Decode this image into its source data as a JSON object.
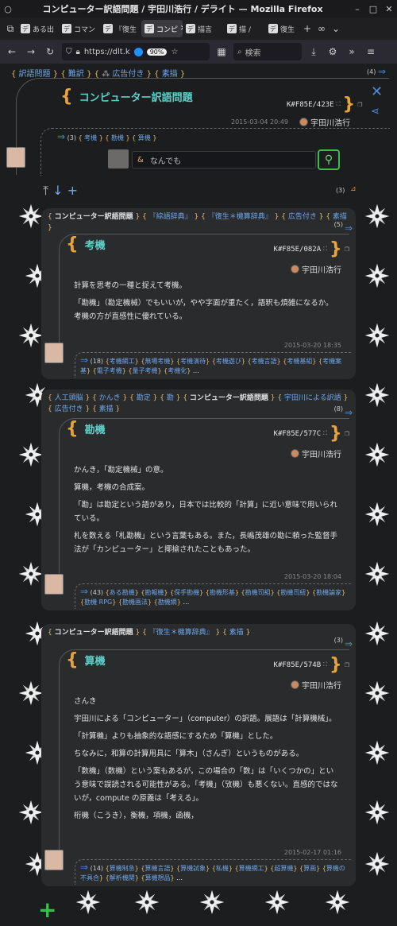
{
  "window": {
    "title": "コンピューター訳語問題 / 宇田川浩行 / デライト — Mozilla Firefox"
  },
  "tabs": [
    "ある出",
    "コマン",
    "『復生",
    "コンピ",
    "描言",
    "描 /",
    "復生"
  ],
  "nav": {
    "url": "https://dlt.k",
    "zoom": "90%",
    "search_placeholder": "検索"
  },
  "page": {
    "header_tags": [
      "訳語問題",
      "難訳",
      "広告付き",
      "素描"
    ],
    "header_count": "(4)",
    "title": "コンピューター訳語問題",
    "kid": "K#F85E/423E",
    "date": "2015-03-04 20:49",
    "author": "宇田川浩行",
    "sub_count": "(3)",
    "sub_tags": [
      "考機",
      "勘機",
      "算機"
    ],
    "input_placeholder": "なんでも",
    "child_count": "(3)"
  },
  "cards": [
    {
      "crumbs": [
        "コンピューター訳語問題",
        "『綜語辞典』",
        "『復生＊機算辞典』",
        "広告付き",
        "素描"
      ],
      "crumb_count": "(5)",
      "title": "考機",
      "kid": "K#F85E/082A",
      "author": "宇田川浩行",
      "paras": [
        "計算を思考の一種と捉えて考機。",
        "「勘機」（勘定機械）でもいいが，やや字面が重たく，語釈も煩雑になるか。考機の方が直感性に優れている。"
      ],
      "date": "2015-03-20 18:35",
      "tag_count": "(18)",
      "tags": [
        "考機網工",
        "無場考機",
        "考機演待",
        "考機遊び",
        "考機言語",
        "考機基組",
        "考機案基",
        "電子考機",
        "量子考機",
        "考機化"
      ]
    },
    {
      "crumbs": [
        "人工頭脳",
        "かんき",
        "勘定",
        "勘",
        "コンピューター訳語問題",
        "宇田川による訳語",
        "広告付き",
        "素描"
      ],
      "crumb_count": "(8)",
      "title": "勘機",
      "kid": "K#F85E/577C",
      "author": "宇田川浩行",
      "paras": [
        "かんき，「勘定機械」の意。",
        "算機，考機の合成案。",
        "「勘」は勘定という語があり，日本では比較的「計算」に近い意味で用いられている。",
        "札を数える「札勘機」という言葉もある。また，長嶋茂雄の勘に頼った監督手法が「カンピューター」と揶揄されたこともあった。"
      ],
      "date": "2015-03-20 18:04",
      "tag_count": "(43)",
      "tags": [
        "ある勘機",
        "勘報機",
        "保手勘機",
        "勘機形基",
        "勘機司組",
        "勘機司紐",
        "勘機論家",
        "勘機 RPG",
        "勘機画法",
        "勘機網"
      ]
    },
    {
      "crumbs": [
        "コンピューター訳語問題",
        "『復生＊機算辞典』",
        "素描"
      ],
      "crumb_count": "(3)",
      "title": "算機",
      "kid": "K#F85E/574B",
      "author": "宇田川浩行",
      "paras": [
        "さんき",
        "宇田川による「コンピューター」（computer）の訳語。展語は「計算機械」。",
        "「計算機」よりも抽象的な語感にするため「算機」とした。",
        "ちなみに，和算の計算用具に「算木」（さんぎ）というものがある。",
        "「数機」（数機）という案もあるが，この場合の「数」は「いくつかの」という意味で誤読される可能性がある。「考機」（攷機）も悪くない。直感的ではないが，compute の原義は「考える」。",
        "桁機（こうき），衡機，項機，函機，"
      ],
      "date": "2015-02-17 01:16",
      "tag_count": "(14)",
      "tags": [
        "算機制急",
        "算機言語",
        "算機試象",
        "私機",
        "算機網工",
        "超算機",
        "算画",
        "算機の不具合",
        "解析機関",
        "算機想品"
      ]
    }
  ],
  "colors": {
    "accent": "#5ed0c8",
    "brace": "#e8a33a",
    "link": "#6ea6e8",
    "bg": "#1c1d1f"
  }
}
